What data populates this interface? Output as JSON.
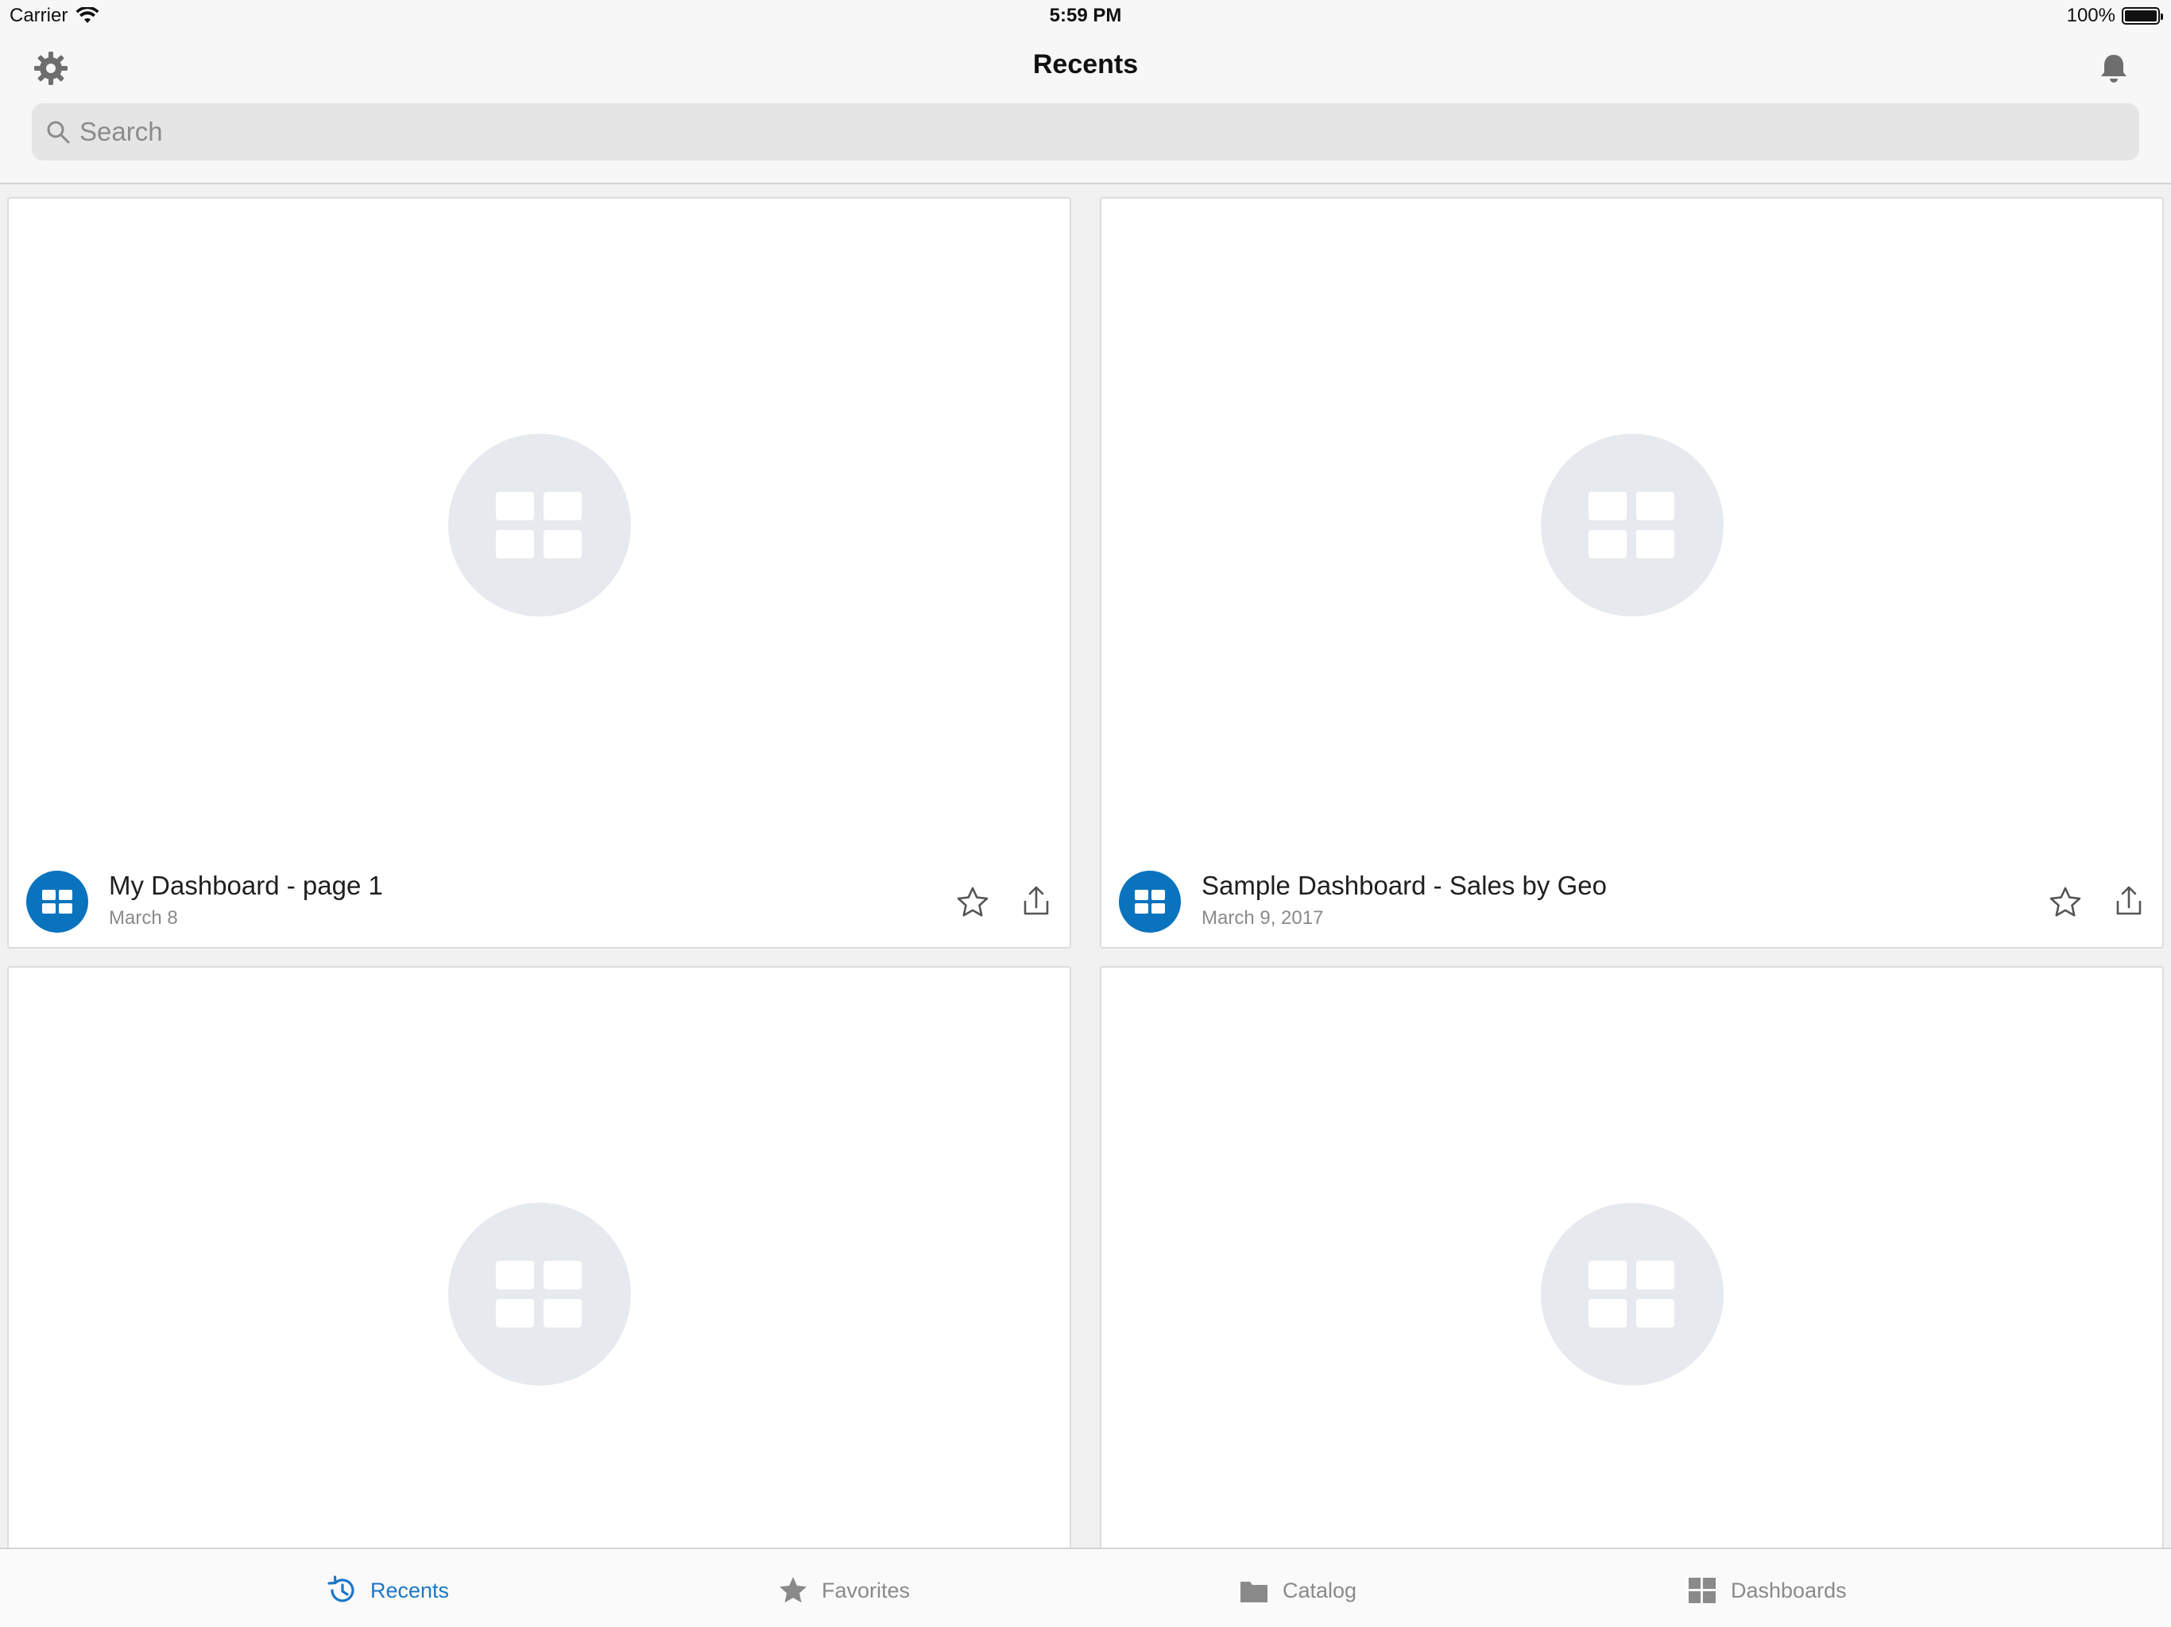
{
  "status_bar": {
    "carrier": "Carrier",
    "time": "5:59 PM",
    "battery": "100%"
  },
  "nav": {
    "title": "Recents",
    "settings_icon": "gear-icon",
    "notifications_icon": "bell-icon"
  },
  "search": {
    "placeholder": "Search",
    "value": ""
  },
  "cards": [
    {
      "title": "My Dashboard - page 1",
      "date": "March 8"
    },
    {
      "title": "Sample Dashboard - Sales by Geo",
      "date": "March 9, 2017"
    },
    {
      "title": "",
      "date": ""
    },
    {
      "title": "",
      "date": ""
    }
  ],
  "tabs": [
    {
      "label": "Recents",
      "icon": "history-icon",
      "active": true
    },
    {
      "label": "Favorites",
      "icon": "star-icon",
      "active": false
    },
    {
      "label": "Catalog",
      "icon": "folder-icon",
      "active": false
    },
    {
      "label": "Dashboards",
      "icon": "grid-icon",
      "active": false
    }
  ],
  "colors": {
    "accent": "#1a77c9",
    "badge": "#0a73be",
    "placeholder_circle": "#e6eaee",
    "background": "#f1f1f1"
  }
}
